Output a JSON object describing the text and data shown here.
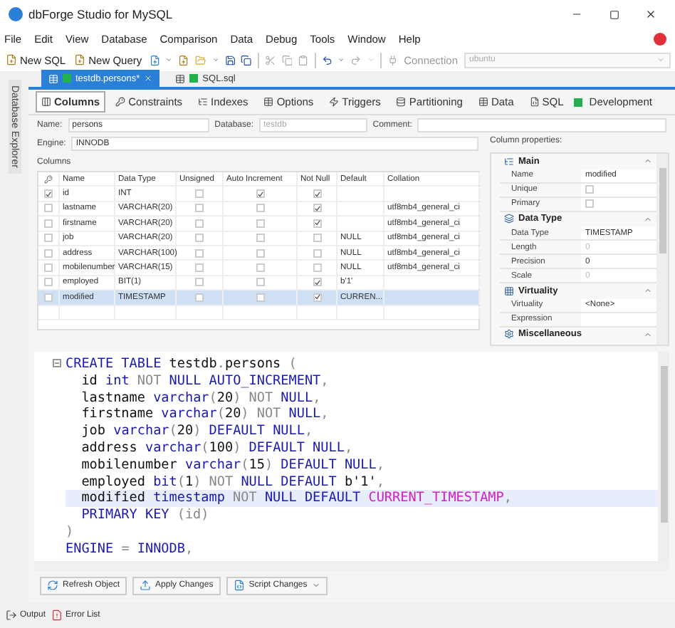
{
  "window": {
    "title": "dbForge Studio for MySQL"
  },
  "menu": [
    "File",
    "Edit",
    "View",
    "Database",
    "Comparison",
    "Data",
    "Debug",
    "Tools",
    "Window",
    "Help"
  ],
  "toolbar": {
    "buttons": [
      "New SQL",
      "New Query"
    ],
    "connection_label": "Connection",
    "connection": "ubuntu"
  },
  "side_panel": "Database Explorer",
  "doc_tabs": [
    {
      "label": "testdb.persons*",
      "selected": true
    },
    {
      "label": "SQL.sql",
      "selected": false
    }
  ],
  "editor_tabs": [
    {
      "label": "Columns",
      "selected": true
    },
    {
      "label": "Constraints",
      "selected": false
    },
    {
      "label": "Indexes",
      "selected": false
    },
    {
      "label": "Options",
      "selected": false
    },
    {
      "label": "Triggers",
      "selected": false
    },
    {
      "label": "Partitioning",
      "selected": false
    },
    {
      "label": "Data",
      "selected": false
    },
    {
      "label": "SQL",
      "selected": false
    }
  ],
  "environment": "Development",
  "form": {
    "name_label": "Name:",
    "name": "persons",
    "database_label": "Database:",
    "database": "testdb",
    "comment_label": "Comment:"
  },
  "engine": {
    "label": "Engine:",
    "value": "INNODB"
  },
  "columns_group": "Columns",
  "table": {
    "columns": [
      "Name",
      "Data Type",
      "Unsigned",
      "Auto Increment",
      "Not Null",
      "Default",
      "Collation"
    ],
    "rows": [
      {
        "primary": true,
        "name": "id",
        "data_type": "INT",
        "unsigned": false,
        "auto_increment": true,
        "not_null": true,
        "selected": false
      },
      {
        "primary": false,
        "name": "lastname",
        "data_type": "VARCHAR(20)",
        "unsigned": false,
        "auto_increment": false,
        "not_null": true,
        "collation": "utf8mb4_general_ci",
        "selected": false
      },
      {
        "primary": false,
        "name": "firstname",
        "data_type": "VARCHAR(20)",
        "unsigned": false,
        "auto_increment": false,
        "not_null": true,
        "collation": "utf8mb4_general_ci",
        "selected": false
      },
      {
        "primary": false,
        "name": "job",
        "data_type": "VARCHAR(20)",
        "unsigned": false,
        "auto_increment": false,
        "not_null": false,
        "default": "NULL",
        "collation": "utf8mb4_general_ci",
        "selected": false
      },
      {
        "primary": false,
        "name": "address",
        "data_type": "VARCHAR(100)",
        "unsigned": false,
        "auto_increment": false,
        "not_null": false,
        "default": "NULL",
        "collation": "utf8mb4_general_ci",
        "selected": false
      },
      {
        "primary": false,
        "name": "mobilenumber",
        "data_type": "VARCHAR(15)",
        "unsigned": false,
        "auto_increment": false,
        "not_null": false,
        "default": "NULL",
        "collation": "utf8mb4_general_ci",
        "selected": false
      },
      {
        "primary": false,
        "name": "employed",
        "data_type": "BIT(1)",
        "unsigned": false,
        "auto_increment": false,
        "not_null": true,
        "default": "b'1'",
        "selected": false
      },
      {
        "primary": false,
        "name": "modified",
        "data_type": "TIMESTAMP",
        "unsigned": false,
        "auto_increment": false,
        "not_null": true,
        "default": "CURREN...",
        "selected": true
      }
    ]
  },
  "properties": {
    "title": "Column properties:",
    "sections": [
      {
        "title": "Main",
        "rows": [
          {
            "label": "Name",
            "kind": "text",
            "value": "modified",
            "disabled": false
          },
          {
            "label": "Unique",
            "kind": "checkbox",
            "checked": false
          },
          {
            "label": "Primary",
            "kind": "checkbox",
            "checked": false
          }
        ]
      },
      {
        "title": "Data Type",
        "rows": [
          {
            "label": "Data Type",
            "kind": "text",
            "value": "TIMESTAMP",
            "disabled": false
          },
          {
            "label": "Length",
            "kind": "text",
            "value": "0",
            "disabled": true
          },
          {
            "label": "Precision",
            "kind": "text",
            "value": "0",
            "disabled": false
          },
          {
            "label": "Scale",
            "kind": "text",
            "value": "0",
            "disabled": true
          }
        ]
      },
      {
        "title": "Virtuality",
        "rows": [
          {
            "label": "Virtuality",
            "kind": "text",
            "value": "<None>",
            "disabled": false
          },
          {
            "label": "Expression",
            "kind": "text"
          }
        ]
      },
      {
        "title": "Miscellaneous"
      }
    ]
  },
  "sql": {
    "lines": [
      {
        "selected": false,
        "tokens": [
          {
            "kind": "keyword",
            "text": "CREATE TABLE"
          },
          {
            "kind": "plain",
            "text": " testdb"
          },
          {
            "kind": "gray",
            "text": "."
          },
          {
            "kind": "plain",
            "text": "persons"
          },
          {
            "kind": "gray",
            "text": " ("
          }
        ]
      },
      {
        "selected": false,
        "tokens": [
          {
            "kind": "plain",
            "text": "  id "
          },
          {
            "kind": "keyword",
            "text": "int"
          },
          {
            "kind": "gray",
            "text": " NOT "
          },
          {
            "kind": "keyword",
            "text": "NULL AUTO_INCREMENT"
          },
          {
            "kind": "gray",
            "text": ","
          }
        ]
      },
      {
        "selected": false,
        "tokens": [
          {
            "kind": "plain",
            "text": "  lastname "
          },
          {
            "kind": "keyword",
            "text": "varchar"
          },
          {
            "kind": "gray",
            "text": "("
          },
          {
            "kind": "plain",
            "text": "20"
          },
          {
            "kind": "gray",
            "text": ") NOT "
          },
          {
            "kind": "keyword",
            "text": "NULL"
          },
          {
            "kind": "gray",
            "text": ","
          }
        ]
      },
      {
        "selected": false,
        "tokens": [
          {
            "kind": "plain",
            "text": "  firstname "
          },
          {
            "kind": "keyword",
            "text": "varchar"
          },
          {
            "kind": "gray",
            "text": "("
          },
          {
            "kind": "plain",
            "text": "20"
          },
          {
            "kind": "gray",
            "text": ") NOT "
          },
          {
            "kind": "keyword",
            "text": "NULL"
          },
          {
            "kind": "gray",
            "text": ","
          }
        ]
      },
      {
        "selected": false,
        "tokens": [
          {
            "kind": "plain",
            "text": "  job "
          },
          {
            "kind": "keyword",
            "text": "varchar"
          },
          {
            "kind": "gray",
            "text": "("
          },
          {
            "kind": "plain",
            "text": "20"
          },
          {
            "kind": "gray",
            "text": ") "
          },
          {
            "kind": "keyword",
            "text": "DEFAULT NULL"
          },
          {
            "kind": "gray",
            "text": ","
          }
        ]
      },
      {
        "selected": false,
        "tokens": [
          {
            "kind": "plain",
            "text": "  address "
          },
          {
            "kind": "keyword",
            "text": "varchar"
          },
          {
            "kind": "gray",
            "text": "("
          },
          {
            "kind": "plain",
            "text": "100"
          },
          {
            "kind": "gray",
            "text": ") "
          },
          {
            "kind": "keyword",
            "text": "DEFAULT NULL"
          },
          {
            "kind": "gray",
            "text": ","
          }
        ]
      },
      {
        "selected": false,
        "tokens": [
          {
            "kind": "plain",
            "text": "  mobilenumber "
          },
          {
            "kind": "keyword",
            "text": "varchar"
          },
          {
            "kind": "gray",
            "text": "("
          },
          {
            "kind": "plain",
            "text": "15"
          },
          {
            "kind": "gray",
            "text": ") "
          },
          {
            "kind": "keyword",
            "text": "DEFAULT NULL"
          },
          {
            "kind": "gray",
            "text": ","
          }
        ]
      },
      {
        "selected": false,
        "tokens": [
          {
            "kind": "plain",
            "text": "  employed "
          },
          {
            "kind": "keyword",
            "text": "bit"
          },
          {
            "kind": "gray",
            "text": "("
          },
          {
            "kind": "plain",
            "text": "1"
          },
          {
            "kind": "gray",
            "text": ") NOT "
          },
          {
            "kind": "keyword",
            "text": "NULL DEFAULT"
          },
          {
            "kind": "plain",
            "text": " b'1'"
          },
          {
            "kind": "gray",
            "text": ","
          }
        ]
      },
      {
        "selected": true,
        "tokens": [
          {
            "kind": "plain",
            "text": "  modified "
          },
          {
            "kind": "keyword",
            "text": "timestamp"
          },
          {
            "kind": "gray",
            "text": " NOT "
          },
          {
            "kind": "keyword",
            "text": "NULL DEFAULT "
          },
          {
            "kind": "function",
            "text": "CURRENT_TIMESTAMP"
          },
          {
            "kind": "gray",
            "text": ","
          }
        ]
      },
      {
        "selected": false,
        "tokens": [
          {
            "kind": "keyword",
            "text": "  PRIMARY KEY"
          },
          {
            "kind": "gray",
            "text": " (id)"
          }
        ]
      },
      {
        "selected": false,
        "tokens": [
          {
            "kind": "gray",
            "text": ")"
          }
        ]
      },
      {
        "selected": false,
        "tokens": [
          {
            "kind": "keyword",
            "text": "ENGINE"
          },
          {
            "kind": "gray",
            "text": " = "
          },
          {
            "kind": "keyword",
            "text": "INNODB"
          },
          {
            "kind": "gray",
            "text": ","
          }
        ]
      }
    ]
  },
  "actions": [
    {
      "label": "Refresh Object",
      "dropdown": false
    },
    {
      "label": "Apply Changes",
      "dropdown": false
    },
    {
      "label": "Script Changes",
      "dropdown": true
    }
  ],
  "bottom_tabs": [
    "Output",
    "Error List"
  ]
}
